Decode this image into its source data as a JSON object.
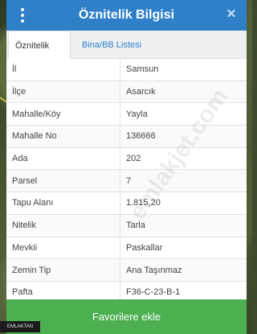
{
  "header": {
    "title": "Öznitelik Bilgisi"
  },
  "tabs": [
    {
      "label": "Öznitelik Bilgisi",
      "active": true
    },
    {
      "label": "Bina/BB Listesi",
      "active": false
    }
  ],
  "rows": [
    {
      "key": "İl",
      "value": "Samsun"
    },
    {
      "key": "İlçe",
      "value": "Asarcık"
    },
    {
      "key": "Mahalle/Köy",
      "value": "Yayla"
    },
    {
      "key": "Mahalle No",
      "value": "136666"
    },
    {
      "key": "Ada",
      "value": "202"
    },
    {
      "key": "Parsel",
      "value": "7"
    },
    {
      "key": "Tapu Alanı",
      "value": "1.815,20"
    },
    {
      "key": "Nitelik",
      "value": "Tarla"
    },
    {
      "key": "Mevkii",
      "value": "Paskallar"
    },
    {
      "key": "Zemin Tip",
      "value": "Ana Taşınmaz"
    },
    {
      "key": "Pafta",
      "value": "F36-C-23-B-1"
    }
  ],
  "footer": {
    "favorite_label": "Favorilere ekle"
  },
  "watermark": "emlakjet.com",
  "brand_logo": "EMLAKTAN",
  "colors": {
    "header": "#2f80c8",
    "button": "#4caf50",
    "tab_link": "#2f80c8"
  }
}
